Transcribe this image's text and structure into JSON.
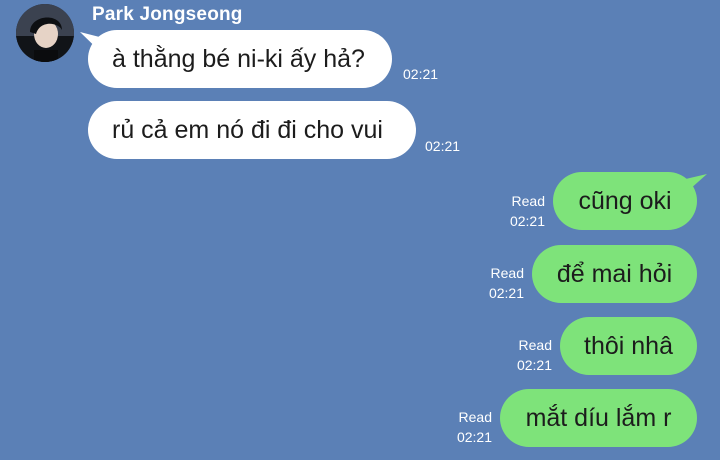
{
  "chat": {
    "sender_name": "Park Jongseong",
    "incoming": [
      {
        "text": "à thằng bé ni-ki ấy hả?",
        "time": "02:21"
      },
      {
        "text": "rủ cả em nó đi đi cho vui",
        "time": "02:21"
      }
    ],
    "outgoing": [
      {
        "text": "cũng oki",
        "status": "Read",
        "time": "02:21"
      },
      {
        "text": "để mai hỏi",
        "status": "Read",
        "time": "02:21"
      },
      {
        "text": "thôi nhâ",
        "status": "Read",
        "time": "02:21"
      },
      {
        "text": "mắt díu lắm r",
        "status": "Read",
        "time": "02:21"
      }
    ]
  },
  "colors": {
    "background": "#5b80b6",
    "incoming_bubble": "#ffffff",
    "outgoing_bubble": "#7ee37a",
    "meta_text": "#ffffff"
  }
}
